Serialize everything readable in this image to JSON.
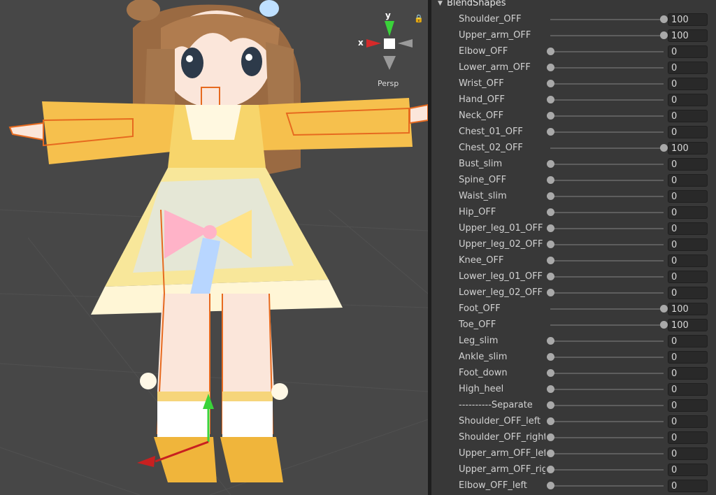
{
  "scene": {
    "gizmo": {
      "x_label": "x",
      "y_label": "y"
    },
    "projection_label": "Persp"
  },
  "inspector": {
    "section_title": "BlendShapes",
    "blendshapes": [
      {
        "label": "Shoulder_OFF",
        "value": 100
      },
      {
        "label": "Upper_arm_OFF",
        "value": 100
      },
      {
        "label": "Elbow_OFF",
        "value": 0
      },
      {
        "label": "Lower_arm_OFF",
        "value": 0
      },
      {
        "label": "Wrist_OFF",
        "value": 0
      },
      {
        "label": "Hand_OFF",
        "value": 0
      },
      {
        "label": "Neck_OFF",
        "value": 0
      },
      {
        "label": "Chest_01_OFF",
        "value": 0
      },
      {
        "label": "Chest_02_OFF",
        "value": 100
      },
      {
        "label": "Bust_slim",
        "value": 0
      },
      {
        "label": "Spine_OFF",
        "value": 0
      },
      {
        "label": "Waist_slim",
        "value": 0
      },
      {
        "label": "Hip_OFF",
        "value": 0
      },
      {
        "label": "Upper_leg_01_OFF",
        "value": 0
      },
      {
        "label": "Upper_leg_02_OFF",
        "value": 0
      },
      {
        "label": "Knee_OFF",
        "value": 0
      },
      {
        "label": "Lower_leg_01_OFF",
        "value": 0
      },
      {
        "label": "Lower_leg_02_OFF",
        "value": 0
      },
      {
        "label": "Foot_OFF",
        "value": 100
      },
      {
        "label": "Toe_OFF",
        "value": 100
      },
      {
        "label": "Leg_slim",
        "value": 0
      },
      {
        "label": "Ankle_slim",
        "value": 0
      },
      {
        "label": "Foot_down",
        "value": 0
      },
      {
        "label": "High_heel",
        "value": 0
      },
      {
        "label": "----------Separate",
        "value": 0
      },
      {
        "label": "Shoulder_OFF_left",
        "value": 0
      },
      {
        "label": "Shoulder_OFF_right",
        "value": 0
      },
      {
        "label": "Upper_arm_OFF_left",
        "value": 0
      },
      {
        "label": "Upper_arm_OFF_right",
        "value": 0
      },
      {
        "label": "Elbow_OFF_left",
        "value": 0
      }
    ]
  }
}
